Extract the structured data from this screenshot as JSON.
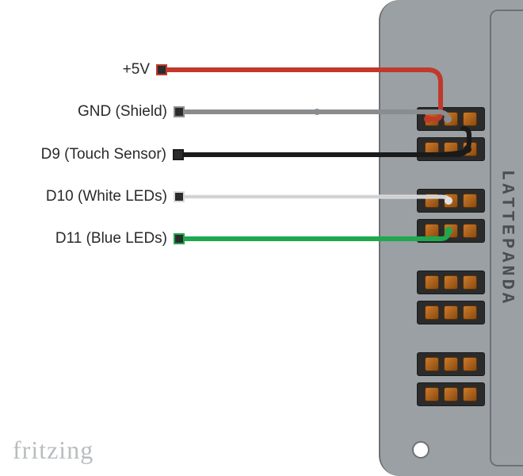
{
  "board_label": "LATTEPANDA",
  "footer": "fritzing",
  "wires": [
    {
      "id": "5v",
      "label": "+5V",
      "color": "#c0392b",
      "terminal_border": "#c0392b",
      "terminal_fill": "#2b2b2b"
    },
    {
      "id": "gnd",
      "label": "GND (Shield)",
      "color": "#8a8d90",
      "terminal_border": "#8a8d90",
      "terminal_fill": "#2b2b2b"
    },
    {
      "id": "d9",
      "label": "D9 (Touch Sensor)",
      "color": "#1a1a1a",
      "terminal_border": "#1a1a1a",
      "terminal_fill": "#2b2b2b"
    },
    {
      "id": "d10",
      "label": "D10 (White LEDs)",
      "color": "#d9d9d9",
      "terminal_border": "#d9d9d9",
      "terminal_fill": "#2b2b2b"
    },
    {
      "id": "d11",
      "label": "D11 (Blue LEDs)",
      "color": "#1fa84d",
      "terminal_border": "#1fa84d",
      "terminal_fill": "#2b2b2b"
    }
  ],
  "pin_headers": 8
}
